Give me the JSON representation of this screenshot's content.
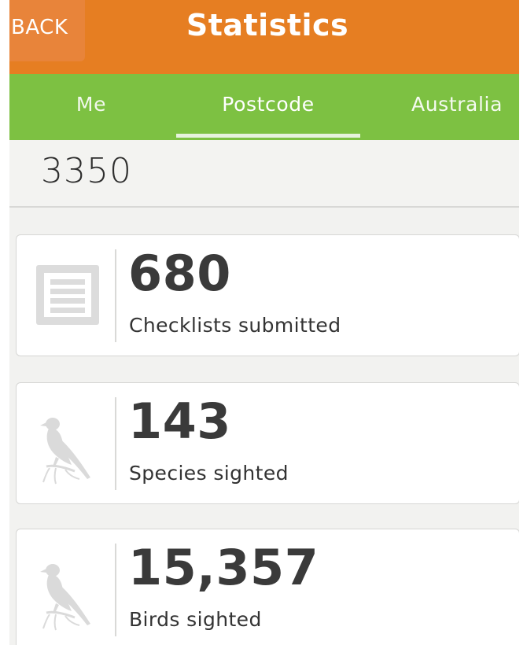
{
  "header": {
    "back_label": "BACK",
    "title": "Statistics",
    "color": "#e67e22"
  },
  "tabs": [
    {
      "label": "Me",
      "selected": false
    },
    {
      "label": "Postcode",
      "selected": true
    },
    {
      "label": "Australia",
      "selected": false
    }
  ],
  "tab_bar_color": "#7dc142",
  "postcode": "3350",
  "stats": [
    {
      "value": "680",
      "label": "Checklists submitted",
      "icon": "checklist-icon"
    },
    {
      "value": "143",
      "label": "Species sighted",
      "icon": "bird-icon"
    },
    {
      "value": "15,357",
      "label": "Birds sighted",
      "icon": "bird-icon"
    }
  ]
}
